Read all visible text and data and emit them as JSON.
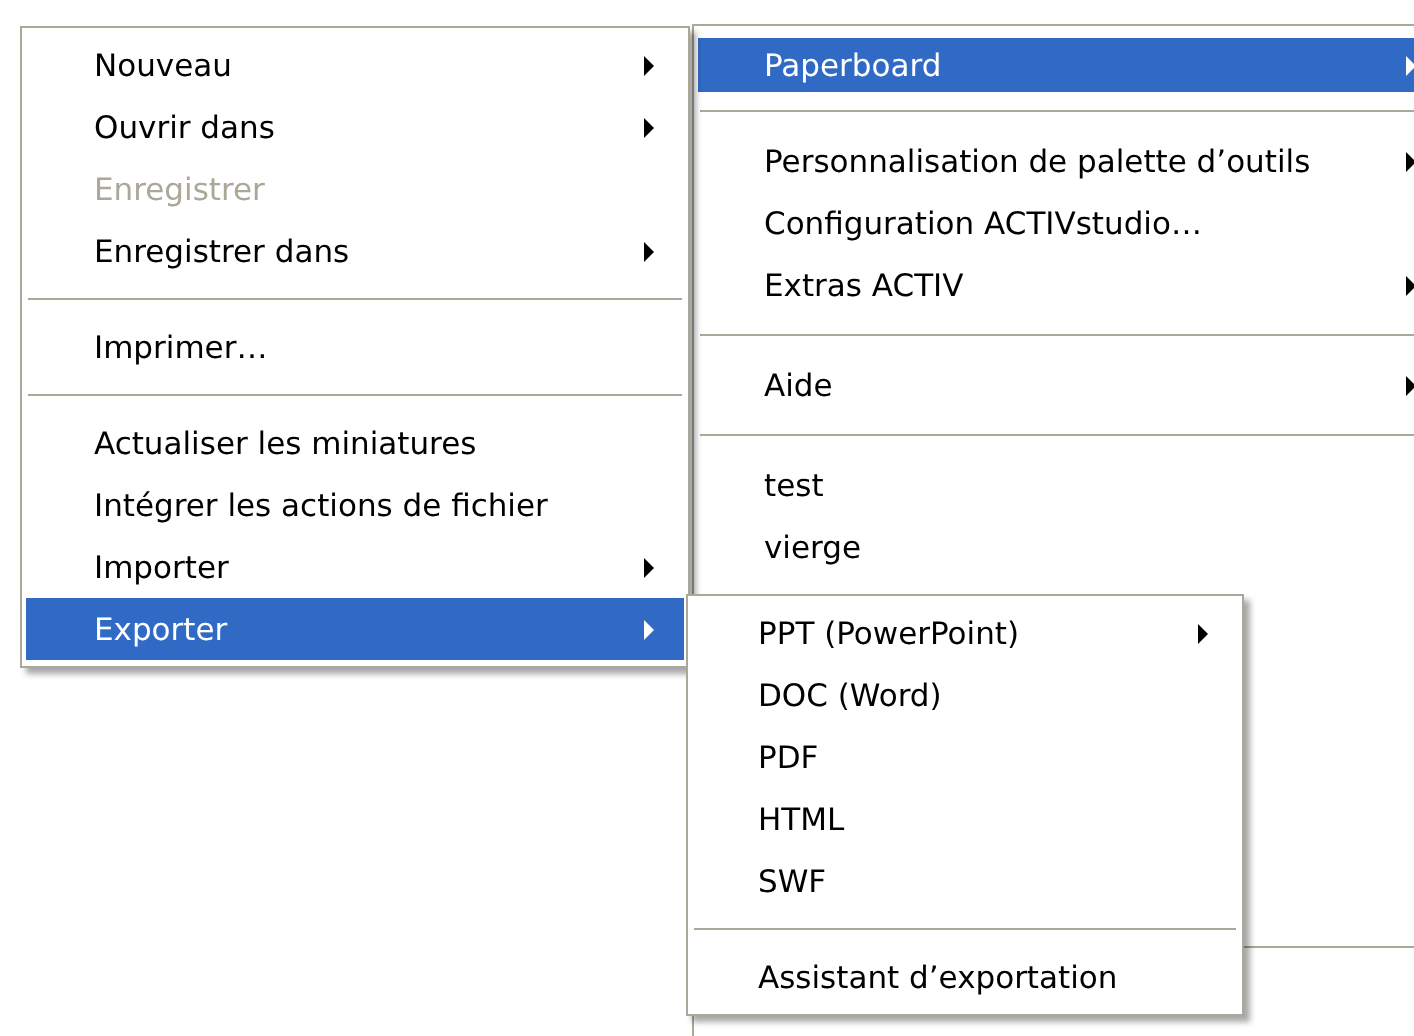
{
  "menus": [
    {
      "kind": "context",
      "items": [
        {
          "kind": "item",
          "label": "Nouveau",
          "submenu": true,
          "disabled": false,
          "selected": false
        },
        {
          "kind": "item",
          "label": "Ouvrir dans",
          "submenu": true,
          "disabled": false,
          "selected": false
        },
        {
          "kind": "item",
          "label": "Enregistrer",
          "submenu": false,
          "disabled": true,
          "selected": false
        },
        {
          "kind": "item",
          "label": "Enregistrer dans",
          "submenu": true,
          "disabled": false,
          "selected": false
        },
        {
          "kind": "separator"
        },
        {
          "kind": "item",
          "label": "Imprimer…",
          "submenu": false,
          "disabled": false,
          "selected": false
        },
        {
          "kind": "separator"
        },
        {
          "kind": "item",
          "label": "Actualiser les miniatures",
          "submenu": false,
          "disabled": false,
          "selected": false
        },
        {
          "kind": "item",
          "label": "Intégrer les actions de fichier",
          "submenu": false,
          "disabled": false,
          "selected": false
        },
        {
          "kind": "item",
          "label": "Importer",
          "submenu": true,
          "disabled": false,
          "selected": false
        },
        {
          "kind": "item",
          "label": "Exporter",
          "submenu": true,
          "disabled": false,
          "selected": true
        }
      ]
    },
    {
      "kind": "main",
      "items": [
        {
          "kind": "item",
          "label": "Paperboard",
          "submenu": true,
          "disabled": false,
          "selected": true
        },
        {
          "kind": "separator"
        },
        {
          "kind": "item",
          "label": "Personnalisation de palette d’outils",
          "submenu": true,
          "disabled": false,
          "selected": false
        },
        {
          "kind": "item",
          "label": "Configuration ACTIVstudio…",
          "submenu": false,
          "disabled": false,
          "selected": false
        },
        {
          "kind": "item",
          "label": "Extras ACTIV",
          "submenu": true,
          "disabled": false,
          "selected": false
        },
        {
          "kind": "separator"
        },
        {
          "kind": "item",
          "label": "Aide",
          "submenu": true,
          "disabled": false,
          "selected": false
        },
        {
          "kind": "separator"
        },
        {
          "kind": "item",
          "label": "test",
          "submenu": false,
          "disabled": false,
          "selected": false
        },
        {
          "kind": "item",
          "label": "vierge",
          "submenu": false,
          "disabled": false,
          "selected": false
        }
      ]
    },
    {
      "kind": "export",
      "items": [
        {
          "kind": "item",
          "label": "PPT (PowerPoint)",
          "submenu": true,
          "disabled": false,
          "selected": false
        },
        {
          "kind": "item",
          "label": "DOC (Word)",
          "submenu": false,
          "disabled": false,
          "selected": false
        },
        {
          "kind": "item",
          "label": "PDF",
          "submenu": false,
          "disabled": false,
          "selected": false
        },
        {
          "kind": "item",
          "label": "HTML",
          "submenu": false,
          "disabled": false,
          "selected": false
        },
        {
          "kind": "item",
          "label": "SWF",
          "submenu": false,
          "disabled": false,
          "selected": false
        },
        {
          "kind": "separator"
        },
        {
          "kind": "item",
          "label": "Assistant d’exportation",
          "submenu": false,
          "disabled": false,
          "selected": false
        }
      ]
    }
  ]
}
